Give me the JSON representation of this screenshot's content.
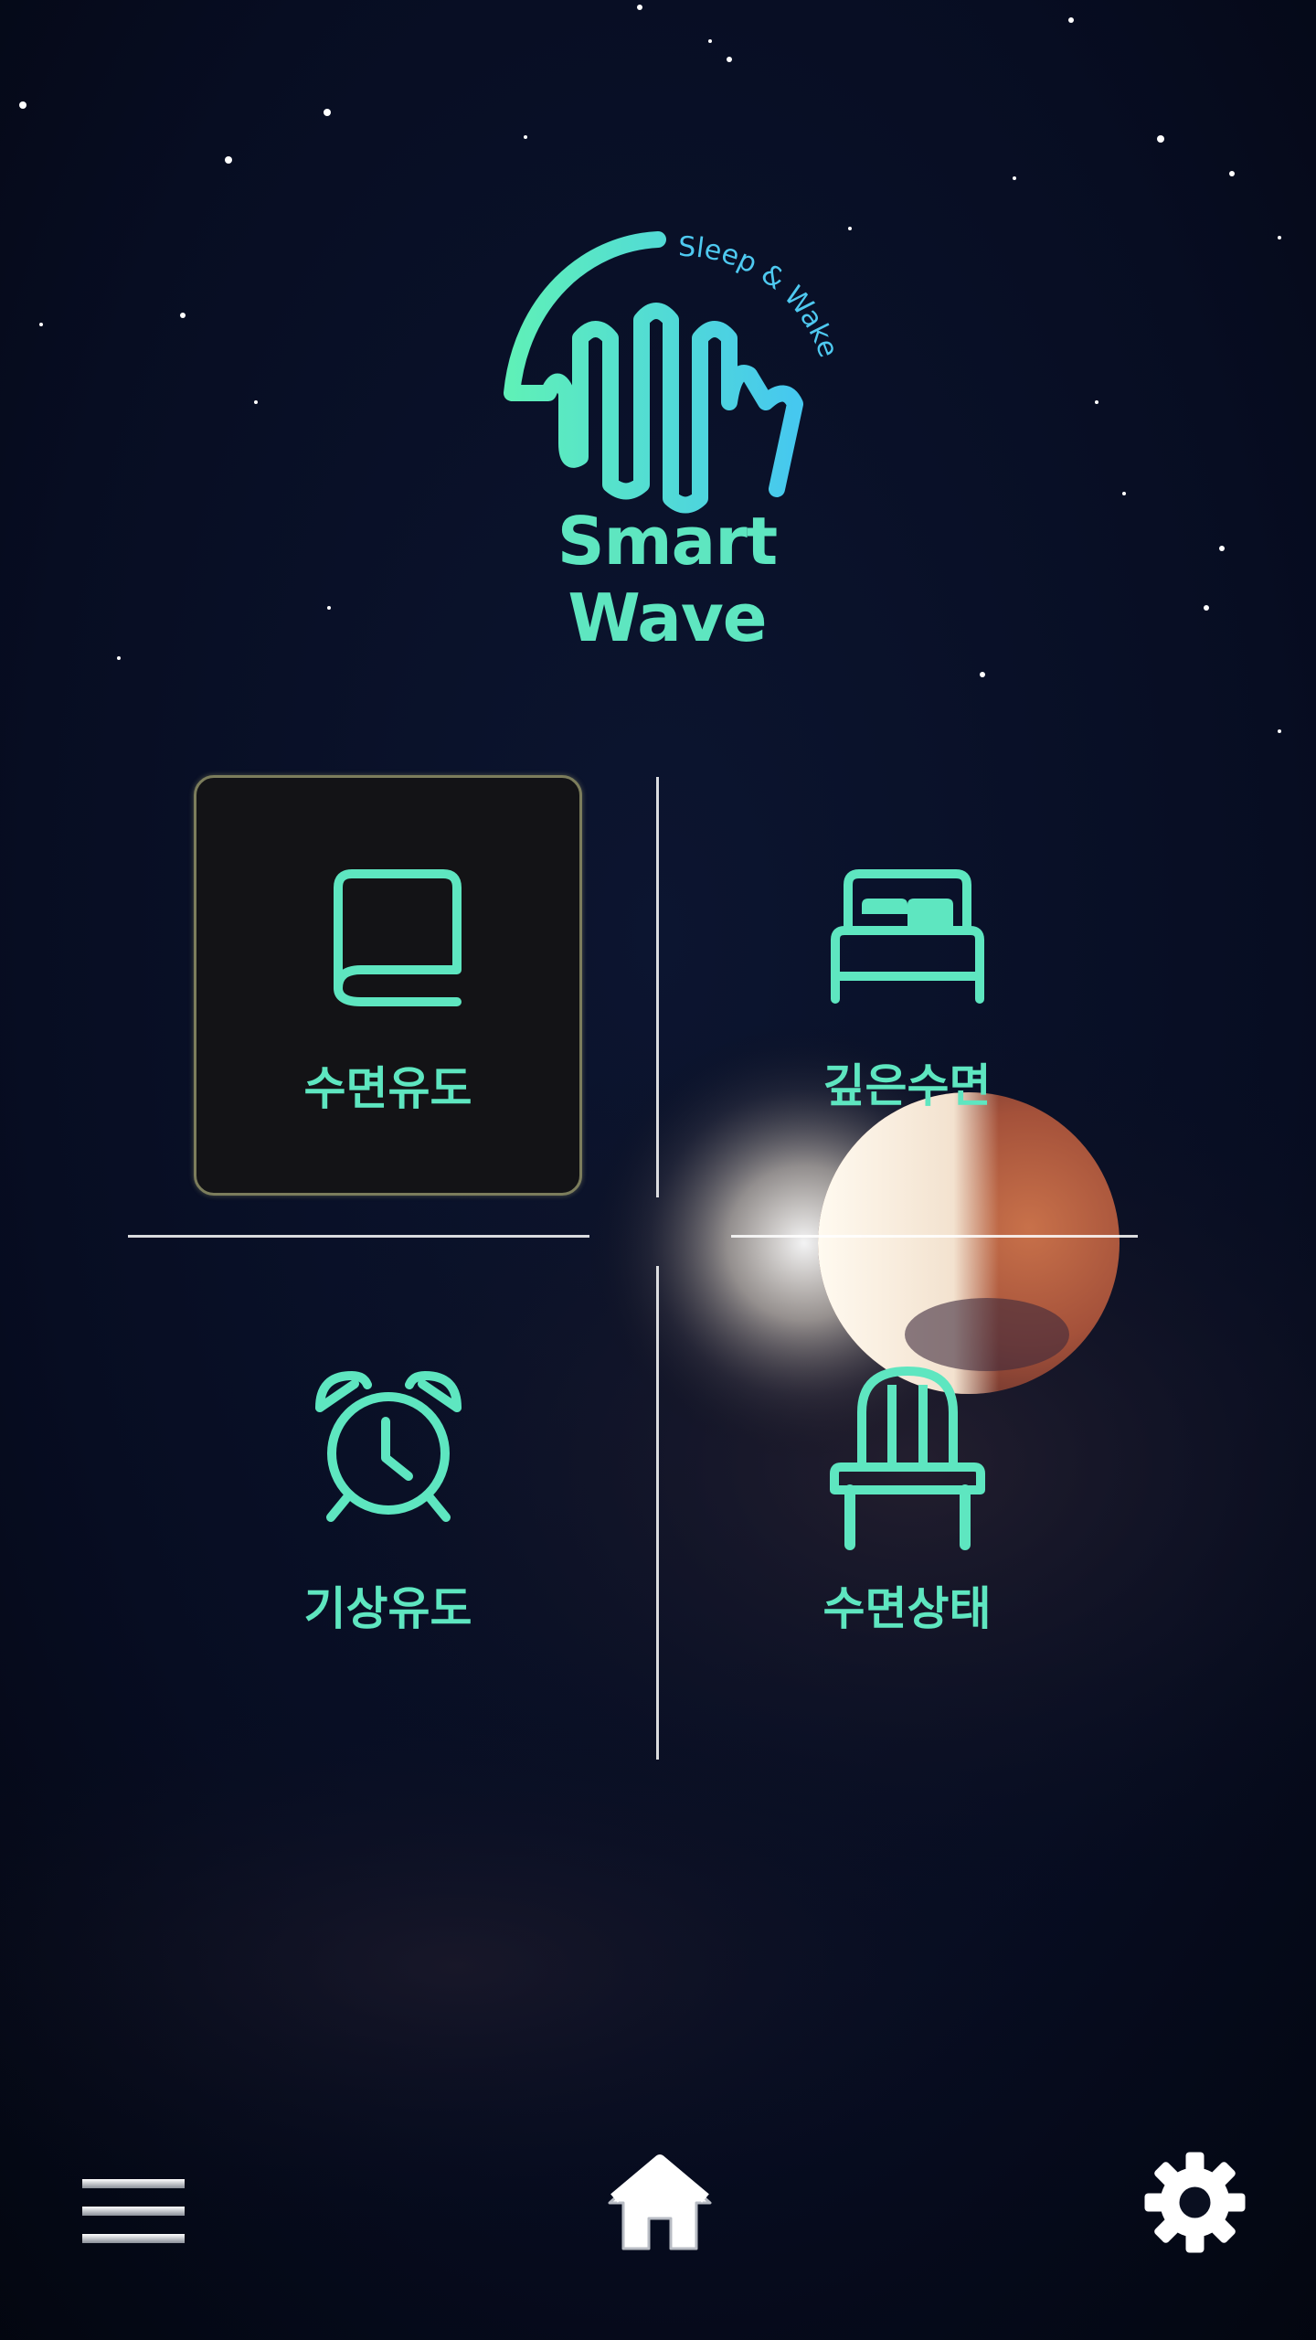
{
  "app": {
    "logo_tagline": "Sleep & Wake",
    "logo_title": "Smart Wave"
  },
  "menu": {
    "items": [
      {
        "id": "sleep-induction",
        "label": "수면유도",
        "icon": "blanket-icon",
        "selected": true
      },
      {
        "id": "deep-sleep",
        "label": "깊은수면",
        "icon": "bed-icon",
        "selected": false
      },
      {
        "id": "wake-induction",
        "label": "기상유도",
        "icon": "alarm-clock-icon",
        "selected": false
      },
      {
        "id": "sleep-state",
        "label": "수면상태",
        "icon": "chair-icon",
        "selected": false
      }
    ]
  },
  "bottom_nav": {
    "left": {
      "icon": "hamburger-menu-icon"
    },
    "center": {
      "icon": "home-icon"
    },
    "right": {
      "icon": "gear-icon"
    }
  },
  "colors": {
    "accent": "#5ee6c0",
    "accent_blue": "#4ec9f0",
    "background": "#060b1c",
    "tile_selected_bg": "#131316",
    "moon": "#b45a3a"
  }
}
